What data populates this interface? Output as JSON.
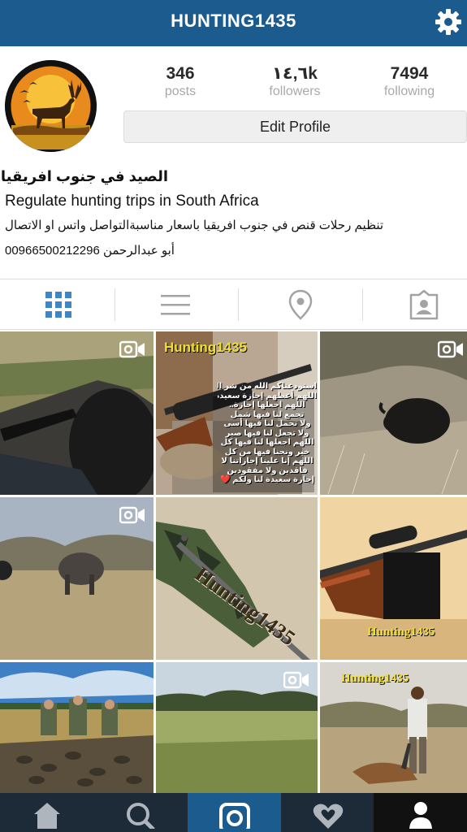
{
  "header": {
    "title": "HUNTING1435",
    "settings_icon": "gear-icon"
  },
  "profile": {
    "avatar_icon": "buck-silhouette-logo",
    "stats": [
      {
        "value": "346",
        "label": "posts"
      },
      {
        "value": "١٤,٦k",
        "label": "followers"
      },
      {
        "value": "7494",
        "label": "following"
      }
    ],
    "edit_label": "Edit Profile",
    "name": "الصيد في جنوب افريقيا",
    "bio_line1": "Regulate hunting trips in South Africa",
    "bio_line2": "تنظيم رحلات قنص في جنوب افريقيا باسعار مناسبةالتواصل واتس او الاتصال",
    "bio_line3": "00966500212296 أبو عبدالرحمن"
  },
  "tabs": [
    {
      "icon": "grid-icon",
      "active": true
    },
    {
      "icon": "list-icon",
      "active": false
    },
    {
      "icon": "location-pin-icon",
      "active": false
    },
    {
      "icon": "tagged-photos-icon",
      "active": false
    }
  ],
  "posts": [
    {
      "caption": "",
      "video": true
    },
    {
      "caption": "Hunting1435",
      "overlay_text": "استودعناكم الله من شر الحوادث والفواجع\nاللهم أعطهم إجازة سعيدة على الجميع\nاللهم اجعلها إجازة..\nتجمع لنا فيها شمل\nولا تحمل لنا فيها أسى\nولا تجعل لنا فيها صبر\nاللهم اجعلها لنا فيها كل\nخير ونجنا فيها من كل\nاللهم إنا علينا إجازاتنا لا\nفاقدين ولا مفقودين\nإجازة سعيدة لنا ولكم ❤️",
      "video": false
    },
    {
      "caption": "",
      "video": true
    },
    {
      "caption": "",
      "video": true
    },
    {
      "caption": "Hunting1435",
      "video": false
    },
    {
      "caption": "Hunting1435",
      "video": false
    },
    {
      "caption": "",
      "video": false
    },
    {
      "caption": "",
      "video": true
    },
    {
      "caption": "Hunting1435",
      "video": false
    }
  ],
  "bottom_nav": [
    {
      "icon": "home-icon"
    },
    {
      "icon": "search-icon"
    },
    {
      "icon": "camera-icon"
    },
    {
      "icon": "activity-heart-icon"
    },
    {
      "icon": "profile-icon"
    }
  ],
  "colors": {
    "header_bg": "#1c5b8e",
    "active_tab": "#3f86c6",
    "bottom_bar": "#1d2a38"
  }
}
